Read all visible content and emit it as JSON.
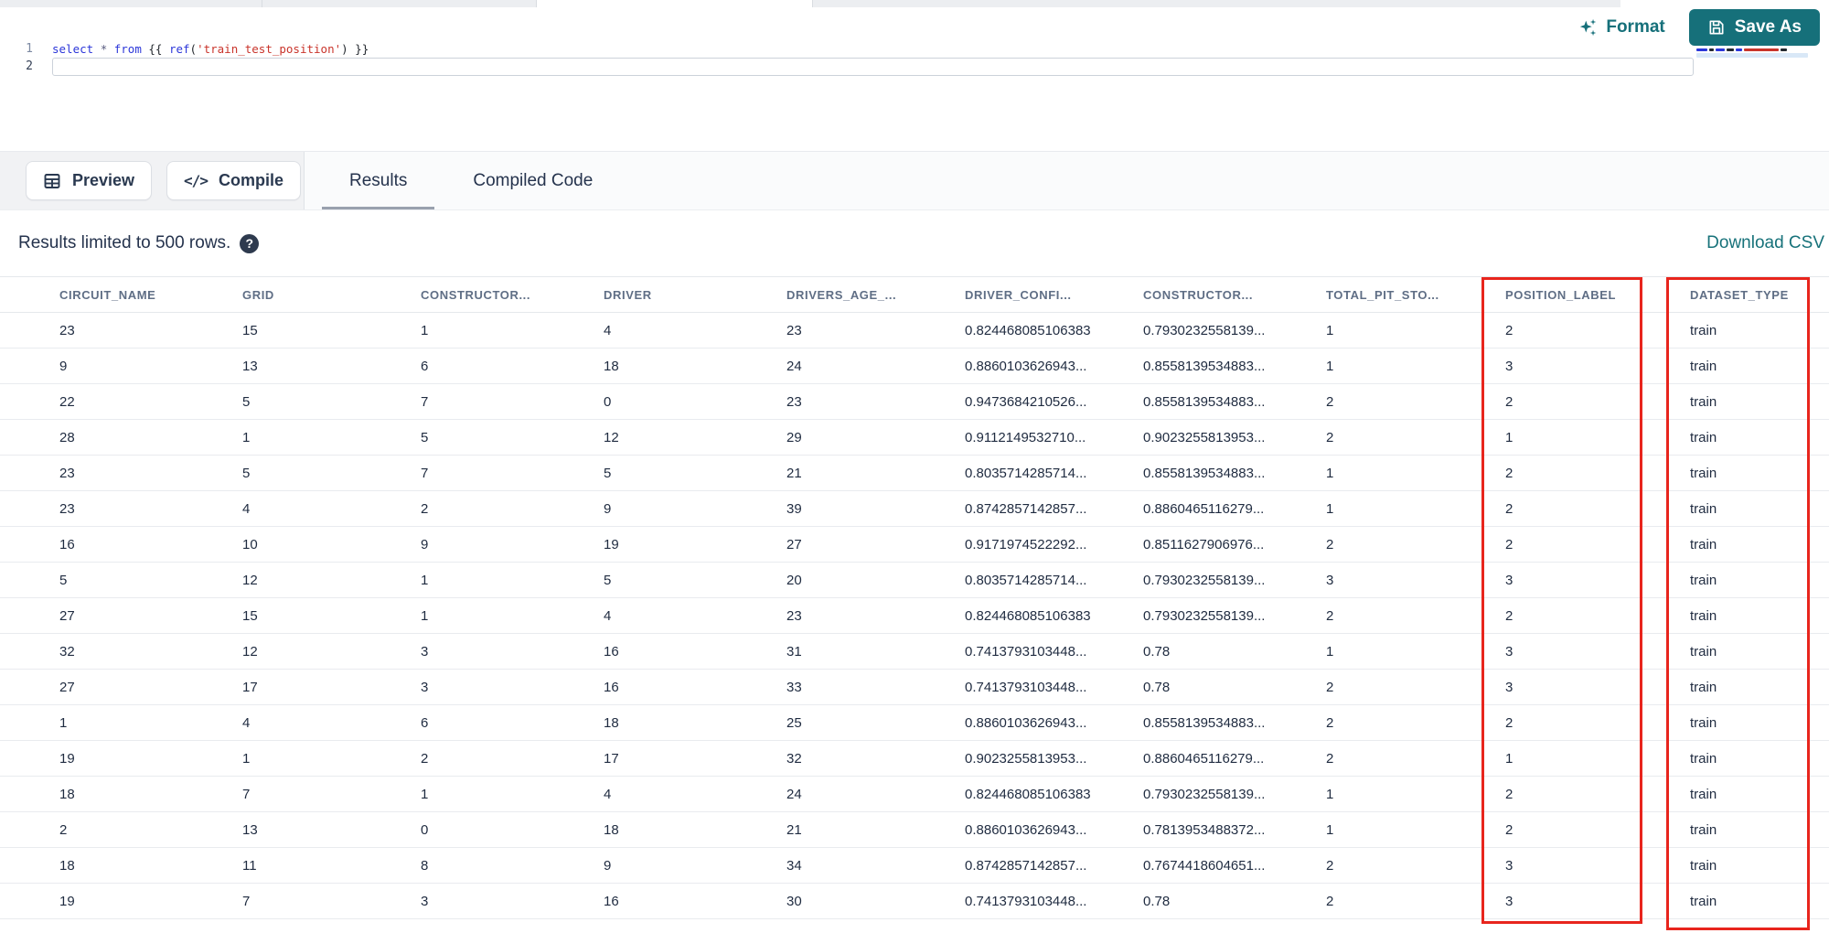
{
  "editor": {
    "line_numbers": [
      "1",
      "2"
    ],
    "code_line": "select * from {{ ref('train_test_position') }}",
    "tokens": [
      {
        "text": "select",
        "type": "keyword"
      },
      {
        "text": " ",
        "type": "plain"
      },
      {
        "text": "*",
        "type": "operator"
      },
      {
        "text": " ",
        "type": "plain"
      },
      {
        "text": "from",
        "type": "keyword"
      },
      {
        "text": " {{ ",
        "type": "plain"
      },
      {
        "text": "ref",
        "type": "function"
      },
      {
        "text": "(",
        "type": "plain"
      },
      {
        "text": "'train_test_position'",
        "type": "string"
      },
      {
        "text": ")",
        "type": "plain"
      },
      {
        "text": " }}",
        "type": "plain"
      }
    ],
    "format_label": "Format",
    "save_as_label": "Save As"
  },
  "toolbar": {
    "preview_label": "Preview",
    "compile_label": "Compile",
    "compile_glyph": "</>",
    "tabs": [
      {
        "label": "Results",
        "active": true
      },
      {
        "label": "Compiled Code",
        "active": false
      }
    ]
  },
  "results": {
    "limit_notice": "Results limited to 500 rows.",
    "help_glyph": "?",
    "download_csv_label": "Download CSV"
  },
  "table": {
    "columns": [
      "CIRCUIT_NAME",
      "GRID",
      "CONSTRUCTOR...",
      "DRIVER",
      "DRIVERS_AGE_...",
      "DRIVER_CONFI...",
      "CONSTRUCTOR...",
      "TOTAL_PIT_STO...",
      "POSITION_LABEL",
      "DATASET_TYPE"
    ],
    "rows": [
      [
        "23",
        "15",
        "1",
        "4",
        "23",
        "0.824468085106383",
        "0.7930232558139...",
        "1",
        "2",
        "train"
      ],
      [
        "9",
        "13",
        "6",
        "18",
        "24",
        "0.8860103626943...",
        "0.8558139534883...",
        "1",
        "3",
        "train"
      ],
      [
        "22",
        "5",
        "7",
        "0",
        "23",
        "0.9473684210526...",
        "0.8558139534883...",
        "2",
        "2",
        "train"
      ],
      [
        "28",
        "1",
        "5",
        "12",
        "29",
        "0.9112149532710...",
        "0.9023255813953...",
        "2",
        "1",
        "train"
      ],
      [
        "23",
        "5",
        "7",
        "5",
        "21",
        "0.8035714285714...",
        "0.8558139534883...",
        "1",
        "2",
        "train"
      ],
      [
        "23",
        "4",
        "2",
        "9",
        "39",
        "0.8742857142857...",
        "0.8860465116279...",
        "1",
        "2",
        "train"
      ],
      [
        "16",
        "10",
        "9",
        "19",
        "27",
        "0.9171974522292...",
        "0.8511627906976...",
        "2",
        "2",
        "train"
      ],
      [
        "5",
        "12",
        "1",
        "5",
        "20",
        "0.8035714285714...",
        "0.7930232558139...",
        "3",
        "3",
        "train"
      ],
      [
        "27",
        "15",
        "1",
        "4",
        "23",
        "0.824468085106383",
        "0.7930232558139...",
        "2",
        "2",
        "train"
      ],
      [
        "32",
        "12",
        "3",
        "16",
        "31",
        "0.7413793103448...",
        "0.78",
        "1",
        "3",
        "train"
      ],
      [
        "27",
        "17",
        "3",
        "16",
        "33",
        "0.7413793103448...",
        "0.78",
        "2",
        "3",
        "train"
      ],
      [
        "1",
        "4",
        "6",
        "18",
        "25",
        "0.8860103626943...",
        "0.8558139534883...",
        "2",
        "2",
        "train"
      ],
      [
        "19",
        "1",
        "2",
        "17",
        "32",
        "0.9023255813953...",
        "0.8860465116279...",
        "2",
        "1",
        "train"
      ],
      [
        "18",
        "7",
        "1",
        "4",
        "24",
        "0.824468085106383",
        "0.7930232558139...",
        "1",
        "2",
        "train"
      ],
      [
        "2",
        "13",
        "0",
        "18",
        "21",
        "0.8860103626943...",
        "0.7813953488372...",
        "1",
        "2",
        "train"
      ],
      [
        "18",
        "11",
        "8",
        "9",
        "34",
        "0.8742857142857...",
        "0.7674418604651...",
        "2",
        "3",
        "train"
      ],
      [
        "19",
        "7",
        "3",
        "16",
        "30",
        "0.7413793103448...",
        "0.78",
        "2",
        "3",
        "train"
      ]
    ],
    "highlighted_columns": [
      "POSITION_LABEL",
      "DATASET_TYPE"
    ]
  },
  "colors": {
    "accent_teal": "#16707a",
    "highlight_red": "#e8251d",
    "code_keyword": "#2b36d9",
    "code_string": "#c9342b"
  }
}
